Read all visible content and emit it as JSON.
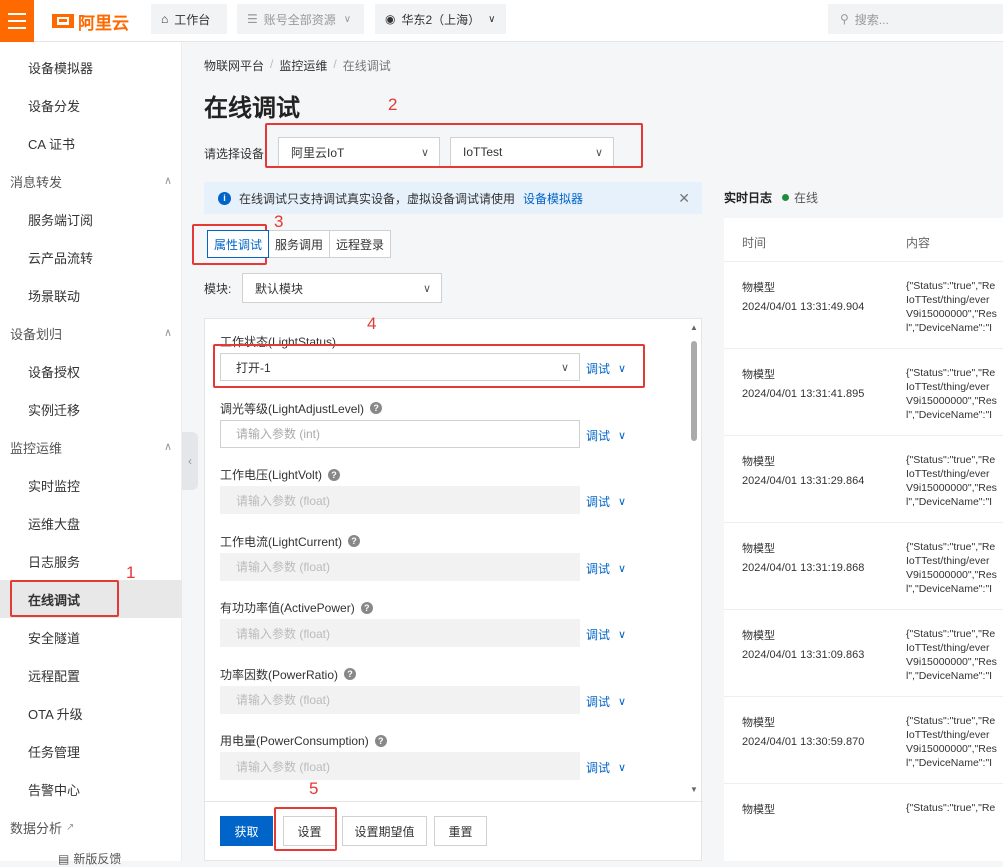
{
  "topbar": {
    "logo_text": "阿里云",
    "workbench": "工作台",
    "account_resources": "账号全部资源",
    "region": "华东2（上海）",
    "search_placeholder": "搜索..."
  },
  "sidebar": {
    "items": [
      {
        "label": "设备模拟器",
        "kind": "sub"
      },
      {
        "label": "设备分发",
        "kind": "sub"
      },
      {
        "label": "CA 证书",
        "kind": "sub"
      },
      {
        "label": "消息转发",
        "kind": "group"
      },
      {
        "label": "服务端订阅",
        "kind": "sub"
      },
      {
        "label": "云产品流转",
        "kind": "sub"
      },
      {
        "label": "场景联动",
        "kind": "sub"
      },
      {
        "label": "设备划归",
        "kind": "group"
      },
      {
        "label": "设备授权",
        "kind": "sub"
      },
      {
        "label": "实例迁移",
        "kind": "sub"
      },
      {
        "label": "监控运维",
        "kind": "group"
      },
      {
        "label": "实时监控",
        "kind": "sub"
      },
      {
        "label": "运维大盘",
        "kind": "sub"
      },
      {
        "label": "日志服务",
        "kind": "sub"
      },
      {
        "label": "在线调试",
        "kind": "sub",
        "active": true
      },
      {
        "label": "安全隧道",
        "kind": "sub"
      },
      {
        "label": "远程配置",
        "kind": "sub"
      },
      {
        "label": "OTA 升级",
        "kind": "sub"
      },
      {
        "label": "任务管理",
        "kind": "sub"
      },
      {
        "label": "告警中心",
        "kind": "sub"
      },
      {
        "label": "数据分析",
        "kind": "group"
      }
    ],
    "footer": "新版反馈"
  },
  "breadcrumb": [
    "物联网平台",
    "监控运维",
    "在线调试"
  ],
  "page_title": "在线调试",
  "device_select": {
    "label": "请选择设备:",
    "product": "阿里云IoT",
    "device": "IoTTest"
  },
  "notice": {
    "text": "在线调试只支持调试真实设备，虚拟设备调试请使用",
    "link": "设备模拟器"
  },
  "tabs": [
    "属性调试",
    "服务调用",
    "远程登录"
  ],
  "module": {
    "label": "模块:",
    "value": "默认模块"
  },
  "properties": [
    {
      "label": "工作状态(LightStatus)",
      "value": "打开-1",
      "placeholder": "",
      "help": false
    },
    {
      "label": "调光等级(LightAdjustLevel)",
      "value": "",
      "placeholder": "请输入参数 (int)",
      "help": true
    },
    {
      "label": "工作电压(LightVolt)",
      "value": "",
      "placeholder": "请输入参数 (float)",
      "help": true
    },
    {
      "label": "工作电流(LightCurrent)",
      "value": "",
      "placeholder": "请输入参数 (float)",
      "help": true
    },
    {
      "label": "有功功率值(ActivePower)",
      "value": "",
      "placeholder": "请输入参数 (float)",
      "help": true
    },
    {
      "label": "功率因数(PowerRatio)",
      "value": "",
      "placeholder": "请输入参数 (float)",
      "help": true
    },
    {
      "label": "用电量(PowerConsumption)",
      "value": "",
      "placeholder": "请输入参数 (float)",
      "help": true
    }
  ],
  "debug_label": "调试",
  "buttons": {
    "get": "获取",
    "set": "设置",
    "set_expected": "设置期望值",
    "reset": "重置"
  },
  "log": {
    "title": "实时日志",
    "status": "在线",
    "columns": [
      "时间",
      "内容"
    ],
    "rows": [
      {
        "type": "物模型",
        "time": "2024/04/01 13:31:49.904",
        "content": [
          "{\"Status\":\"true\",\"Re",
          "IoTTest/thing/ever",
          "V9i15000000\",\"Res",
          "l\",\"DeviceName\":\"I"
        ]
      },
      {
        "type": "物模型",
        "time": "2024/04/01 13:31:41.895",
        "content": [
          "{\"Status\":\"true\",\"Re",
          "IoTTest/thing/ever",
          "V9i15000000\",\"Res",
          "l\",\"DeviceName\":\"I"
        ]
      },
      {
        "type": "物模型",
        "time": "2024/04/01 13:31:29.864",
        "content": [
          "{\"Status\":\"true\",\"Re",
          "IoTTest/thing/ever",
          "V9i15000000\",\"Res",
          "l\",\"DeviceName\":\"I"
        ]
      },
      {
        "type": "物模型",
        "time": "2024/04/01 13:31:19.868",
        "content": [
          "{\"Status\":\"true\",\"Re",
          "IoTTest/thing/ever",
          "V9i15000000\",\"Res",
          "l\",\"DeviceName\":\"I"
        ]
      },
      {
        "type": "物模型",
        "time": "2024/04/01 13:31:09.863",
        "content": [
          "{\"Status\":\"true\",\"Re",
          "IoTTest/thing/ever",
          "V9i15000000\",\"Res",
          "l\",\"DeviceName\":\"I"
        ]
      },
      {
        "type": "物模型",
        "time": "2024/04/01 13:30:59.870",
        "content": [
          "{\"Status\":\"true\",\"Re",
          "IoTTest/thing/ever",
          "V9i15000000\",\"Res",
          "l\",\"DeviceName\":\"I"
        ]
      },
      {
        "type": "物模型",
        "time": "",
        "content": [
          "{\"Status\":\"true\",\"Re"
        ]
      }
    ]
  },
  "annotations": [
    "1",
    "2",
    "3",
    "4",
    "5"
  ],
  "colors": {
    "brand": "#ff6a00",
    "primary": "#0064c8",
    "annotation": "#e53935",
    "online": "#1e8e3e"
  }
}
